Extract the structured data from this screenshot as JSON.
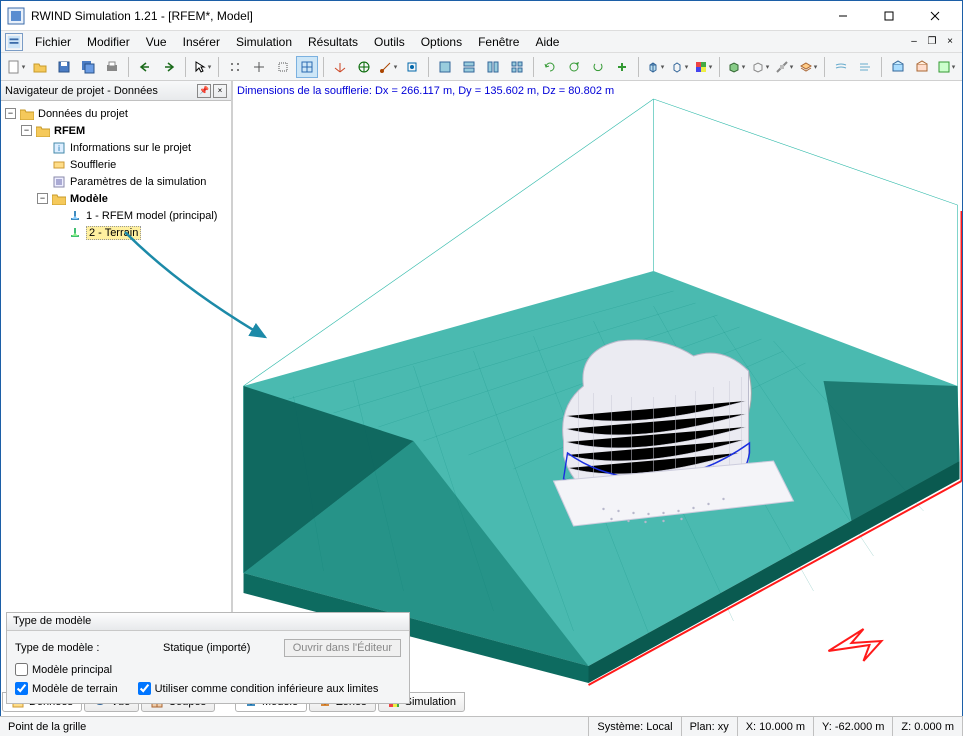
{
  "window": {
    "title": "RWIND Simulation 1.21 - [RFEM*, Model]"
  },
  "menu": [
    "Fichier",
    "Modifier",
    "Vue",
    "Insérer",
    "Simulation",
    "Résultats",
    "Outils",
    "Options",
    "Fenêtre",
    "Aide"
  ],
  "navigator": {
    "header": "Navigateur de projet - Données",
    "root": "Données du projet",
    "rfem": "RFEM",
    "items": [
      "Informations sur le projet",
      "Soufflerie",
      "Paramètres de la simulation"
    ],
    "modele": "Modèle",
    "model_children": [
      "1 - RFEM model (principal)",
      "2 - Terrain"
    ]
  },
  "viewport": {
    "dimensions": "Dimensions de la soufflerie:  Dx = 266.117 m, Dy = 135.602 m, Dz = 80.802 m"
  },
  "modelbox": {
    "title": "Type de modèle",
    "type_label": "Type de modèle :",
    "type_value": "Statique (importé)",
    "open_button": "Ouvrir dans l'Éditeur",
    "chk_principal": "Modèle principal",
    "chk_terrain": "Modèle de terrain",
    "chk_condition": "Utiliser comme condition inférieure aux limites"
  },
  "tabs_left": [
    "Données",
    "Vue",
    "Coupes"
  ],
  "tabs_main": [
    "Modèle",
    "Zones",
    "Simulation"
  ],
  "status": {
    "left": "Point de la grille",
    "system": "Système: Local",
    "plan": "Plan: xy",
    "x": "X: 10.000 m",
    "y": "Y:  -62.000 m",
    "z": "Z:  0.000 m"
  }
}
